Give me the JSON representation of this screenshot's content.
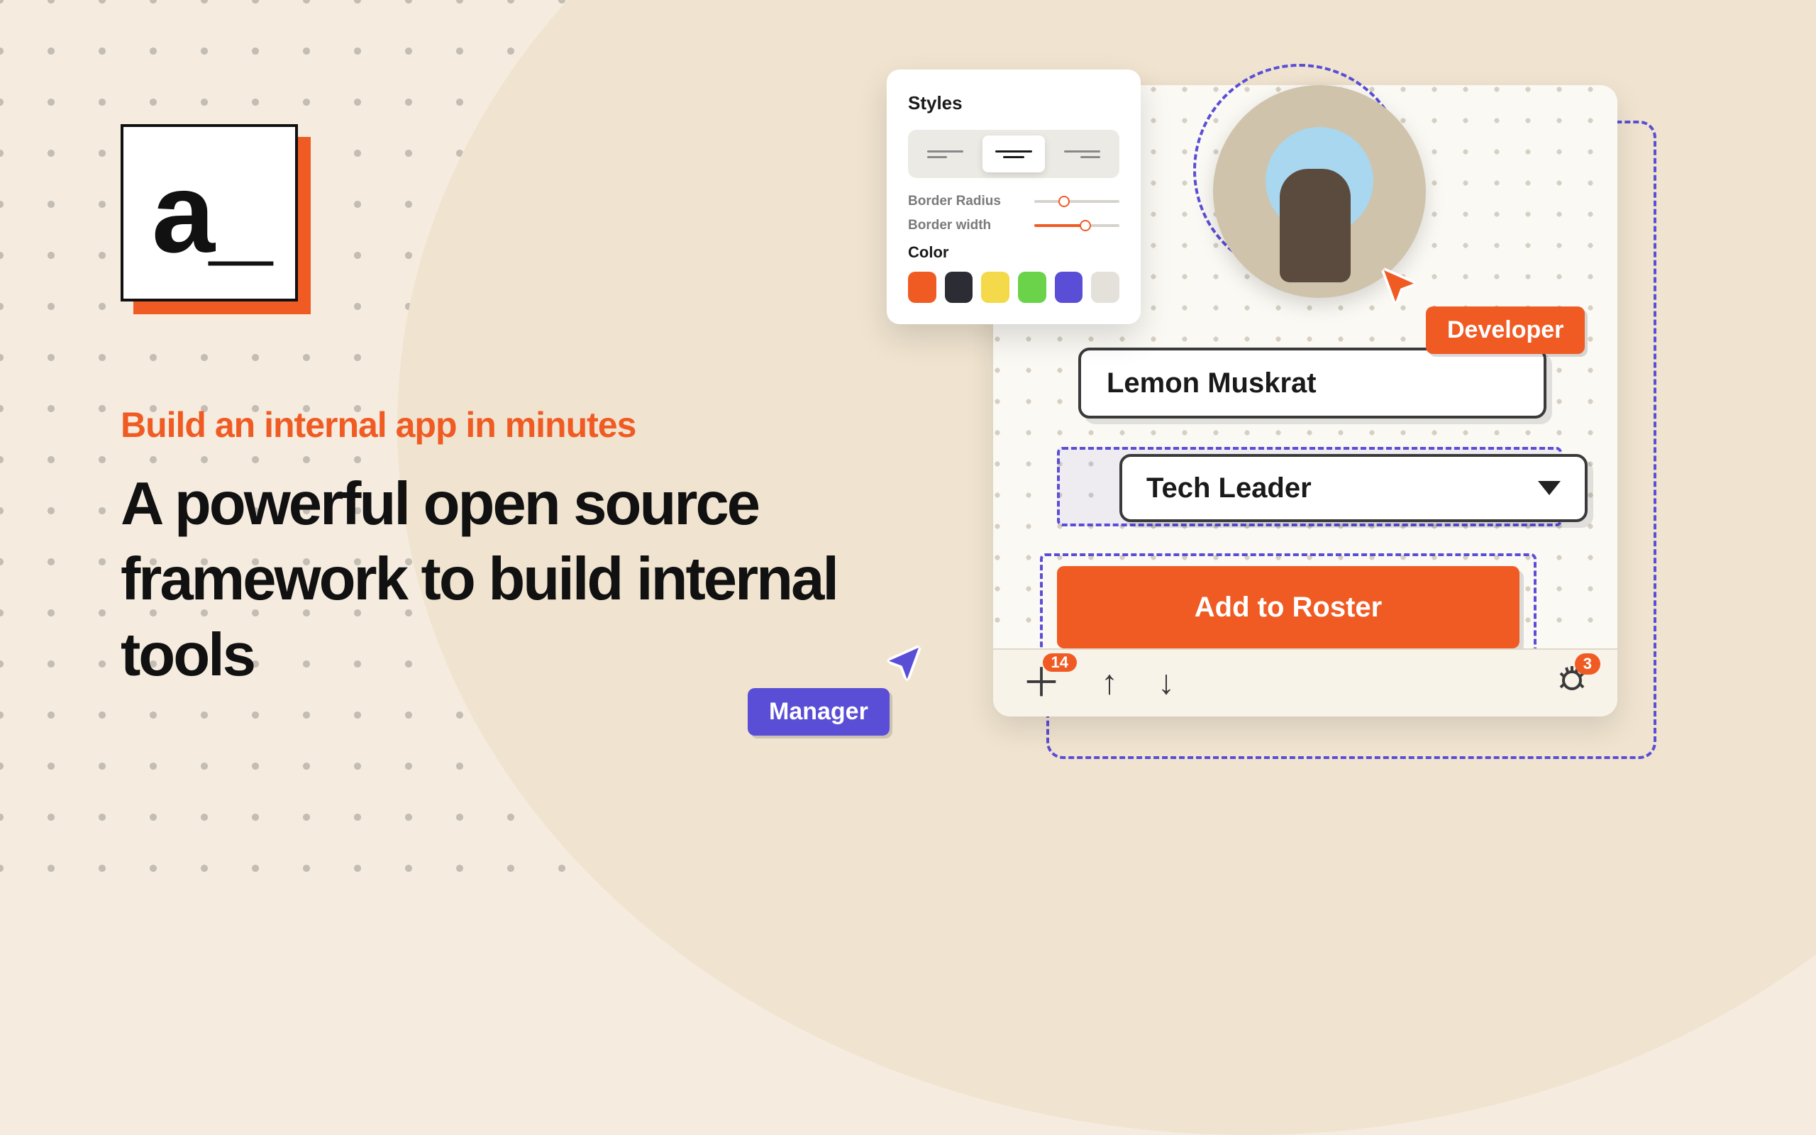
{
  "logo_text": "a_",
  "hero": {
    "subtitle": "Build an internal app in minutes",
    "title": "A powerful open source framework to build internal tools"
  },
  "styles_panel": {
    "title": "Styles",
    "border_radius_label": "Border Radius",
    "border_width_label": "Border width",
    "border_radius_pct": 35,
    "border_width_pct": 60,
    "color_label": "Color",
    "swatches": [
      "#f05b24",
      "#2c2c34",
      "#f4d94a",
      "#6bd34a",
      "#5a4ed6",
      "#e4e1da"
    ]
  },
  "form": {
    "name_value": "Lemon Muskrat",
    "role_value": "Tech Leader",
    "button_label": "Add to Roster"
  },
  "toolbar": {
    "add_badge": "14",
    "debug_badge": "3"
  },
  "tags": {
    "developer": "Developer",
    "manager": "Manager"
  }
}
